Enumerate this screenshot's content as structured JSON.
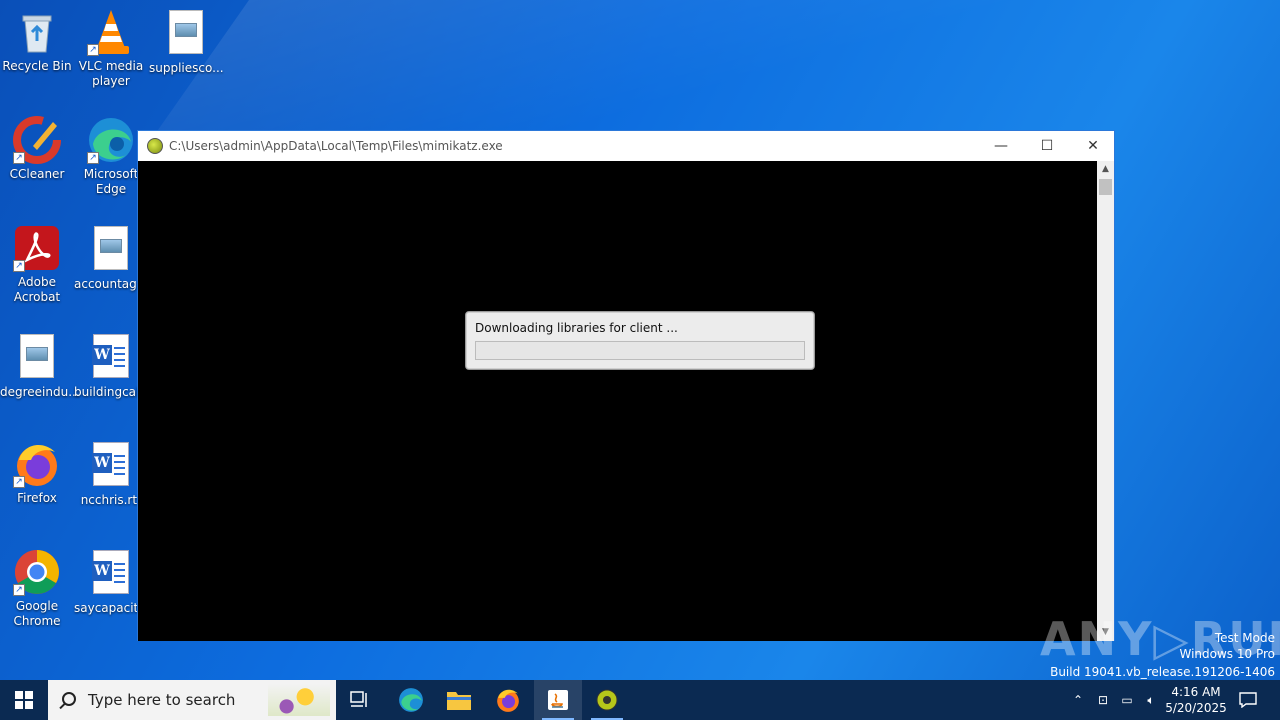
{
  "desktop": {
    "icons": [
      {
        "label": "Recycle Bin",
        "icon": "recycle-bin-icon"
      },
      {
        "label": "VLC media player",
        "icon": "vlc-icon"
      },
      {
        "label": "suppliesco...",
        "icon": "image-file-icon"
      },
      {
        "label": "CCleaner",
        "icon": "ccleaner-icon"
      },
      {
        "label": "Microsoft Edge",
        "icon": "edge-icon"
      },
      {
        "label": "Adobe Acrobat",
        "icon": "acrobat-icon"
      },
      {
        "label": "accountag...",
        "icon": "image-file-icon"
      },
      {
        "label": "degreeindu...",
        "icon": "image-file-icon"
      },
      {
        "label": "buildingcal...",
        "icon": "word-doc-icon"
      },
      {
        "label": "Firefox",
        "icon": "firefox-icon"
      },
      {
        "label": "ncchris.rtf",
        "icon": "word-doc-icon"
      },
      {
        "label": "Google Chrome",
        "icon": "chrome-icon"
      },
      {
        "label": "saycapacit...",
        "icon": "word-doc-icon"
      }
    ]
  },
  "window": {
    "title": "C:\\Users\\admin\\AppData\\Local\\Temp\\Files\\mimikatz.exe",
    "minimize": "—",
    "maximize": "☐",
    "close": "✕"
  },
  "dialog": {
    "message": "Downloading libraries for client ...",
    "progress": 0
  },
  "watermark": {
    "brand": "ANY▷RUN",
    "line1": "Test Mode",
    "line2": "Windows 10 Pro",
    "line3": "Build 19041.vb_release.191206-1406"
  },
  "taskbar": {
    "search_placeholder": "Type here to search",
    "time": "4:16 AM",
    "date": "5/20/2025"
  },
  "colors": {
    "accent": "#2b78d9",
    "taskbar": "#0b2a52",
    "desktop": "#0d6ddf"
  }
}
